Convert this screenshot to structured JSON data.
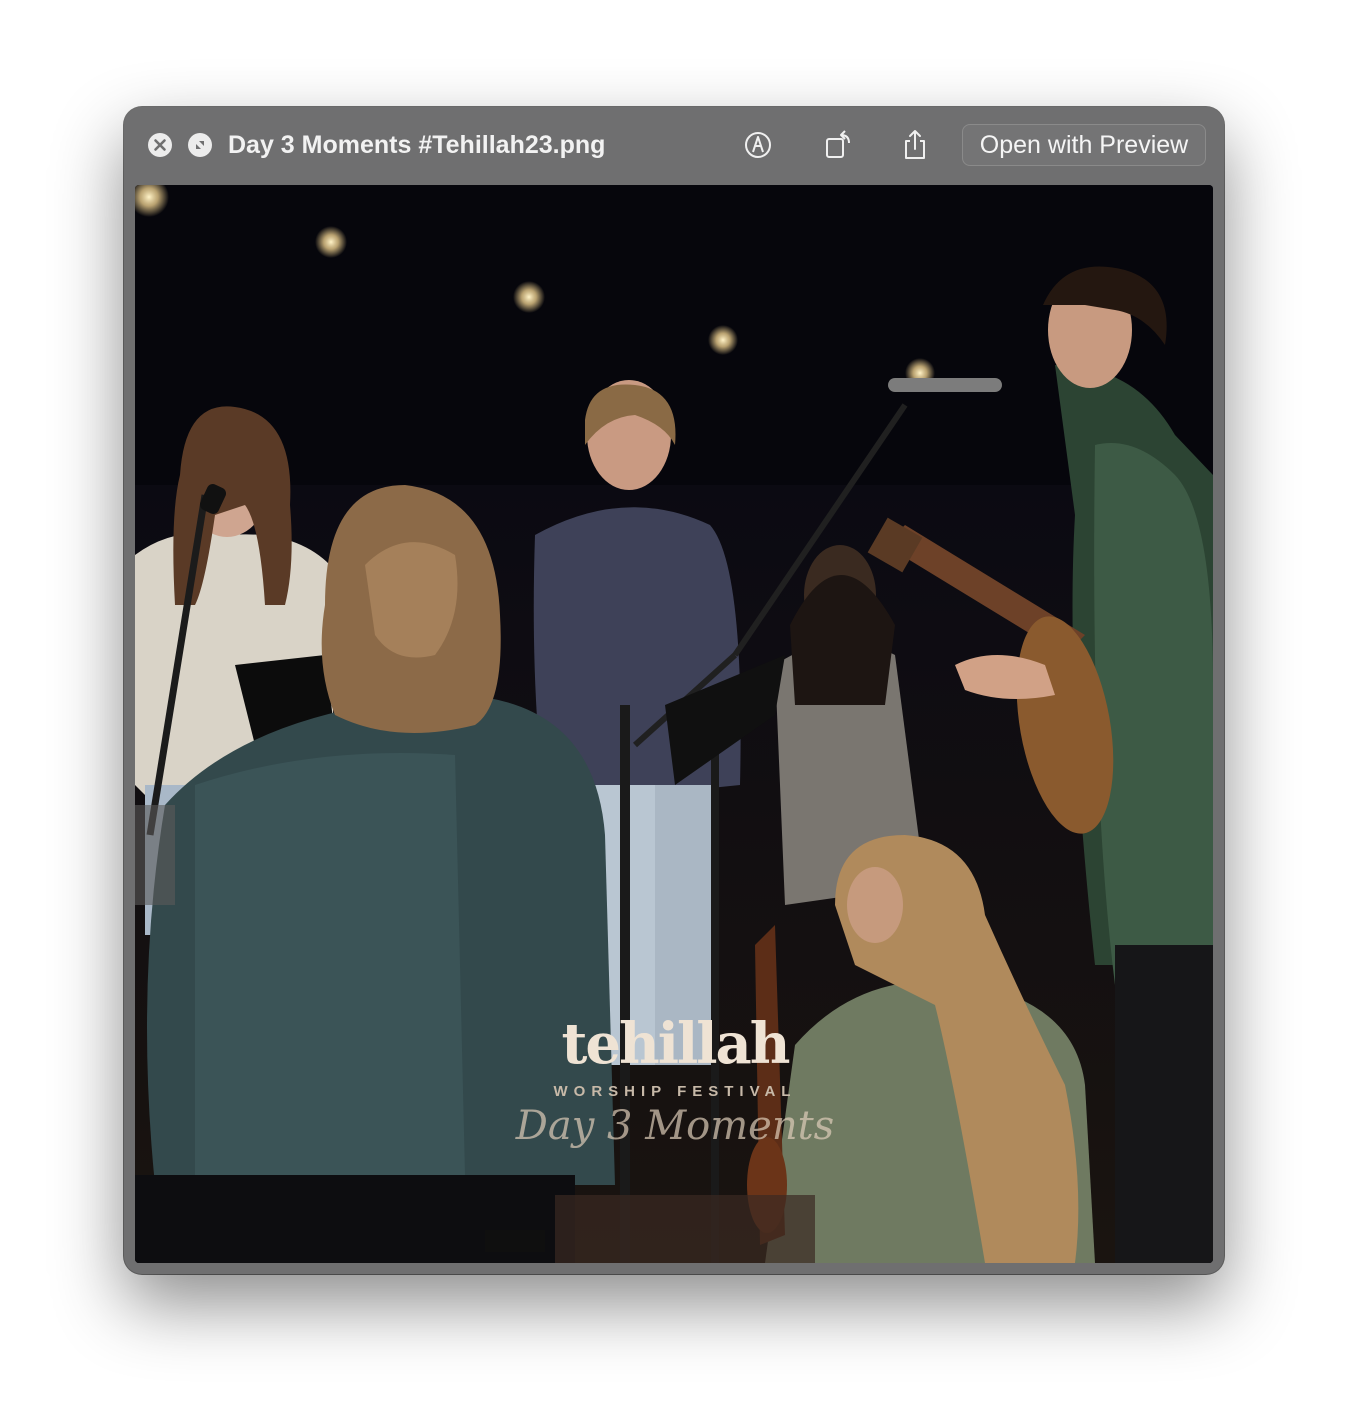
{
  "window": {
    "title": "Day 3 Moments #Tehillah23.png",
    "open_button_label": "Open with Preview"
  },
  "toolbar": {
    "close_icon": "close-icon",
    "fullscreen_icon": "fullscreen-icon",
    "markup_icon": "markup-icon",
    "rotate_icon": "rotate-icon",
    "share_icon": "share-icon"
  },
  "photo": {
    "brand": "tehillah",
    "tagline": "WORSHIP FESTIVAL",
    "caption": "Day 3 Moments"
  }
}
